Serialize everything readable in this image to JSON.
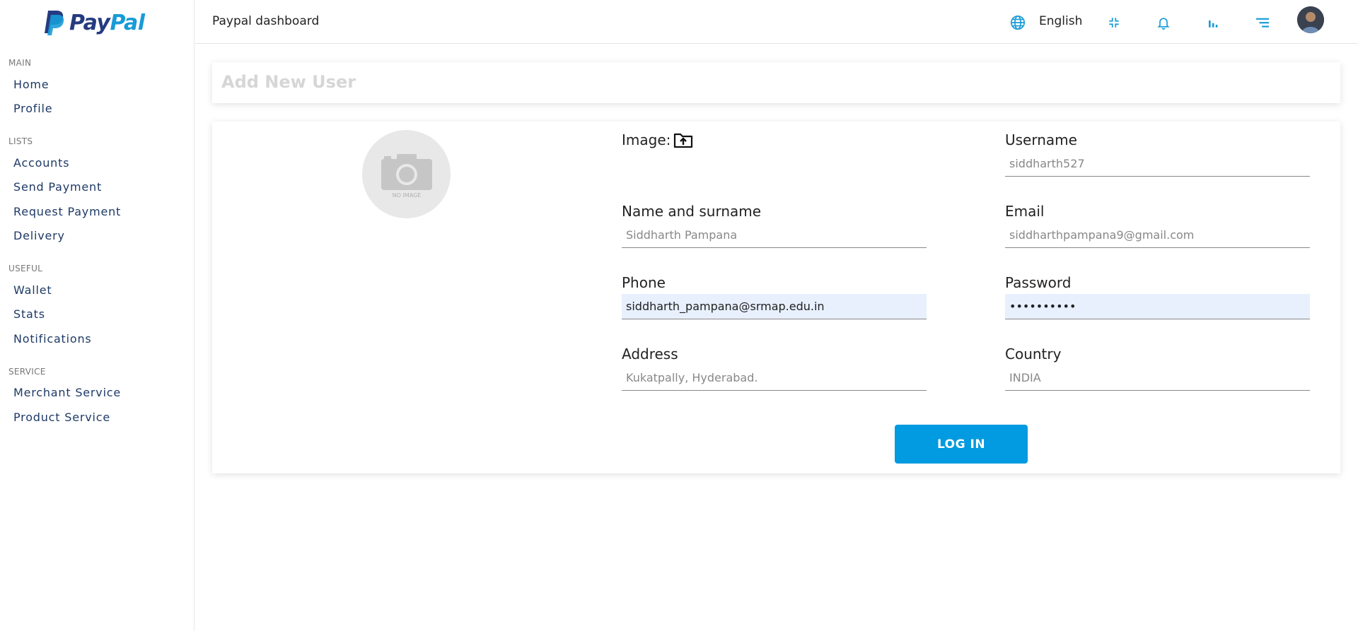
{
  "brand": {
    "logo_pay": "Pay",
    "logo_pal": "Pal",
    "primary_color": "#029ae0",
    "logo_dark": "#253b80",
    "logo_light": "#179bd7"
  },
  "sidebar": {
    "sections": [
      {
        "title": "MAIN",
        "items": [
          "Home",
          "Profile"
        ]
      },
      {
        "title": "LISTS",
        "items": [
          "Accounts",
          "Send Payment",
          "Request Payment",
          "Delivery"
        ]
      },
      {
        "title": "USEFUL",
        "items": [
          "Wallet",
          "Stats",
          "Notifications"
        ]
      },
      {
        "title": "SERVICE",
        "items": [
          "Merchant Service",
          "Product Service"
        ]
      }
    ]
  },
  "topbar": {
    "title": "Paypal dashboard",
    "language": "English",
    "icons": [
      "globe-icon",
      "fullscreen-exit-icon",
      "bell-icon",
      "chart-icon",
      "menu-icon"
    ]
  },
  "page": {
    "heading": "Add New User",
    "image_label": "Image:",
    "image_alt": "NO IMAGE",
    "fields": {
      "username": {
        "label": "Username",
        "placeholder": "siddharth527",
        "value": ""
      },
      "name": {
        "label": "Name and surname",
        "placeholder": "Siddharth Pampana",
        "value": ""
      },
      "email": {
        "label": "Email",
        "placeholder": "siddharthpampana9@gmail.com",
        "value": ""
      },
      "phone": {
        "label": "Phone",
        "placeholder": "",
        "value": "siddharth_pampana@srmap.edu.in"
      },
      "password": {
        "label": "Password",
        "placeholder": "",
        "value": "••••••••••"
      },
      "address": {
        "label": "Address",
        "placeholder": "Kukatpally, Hyderabad.",
        "value": ""
      },
      "country": {
        "label": "Country",
        "placeholder": "INDIA",
        "value": ""
      }
    },
    "submit_label": "LOG IN"
  }
}
